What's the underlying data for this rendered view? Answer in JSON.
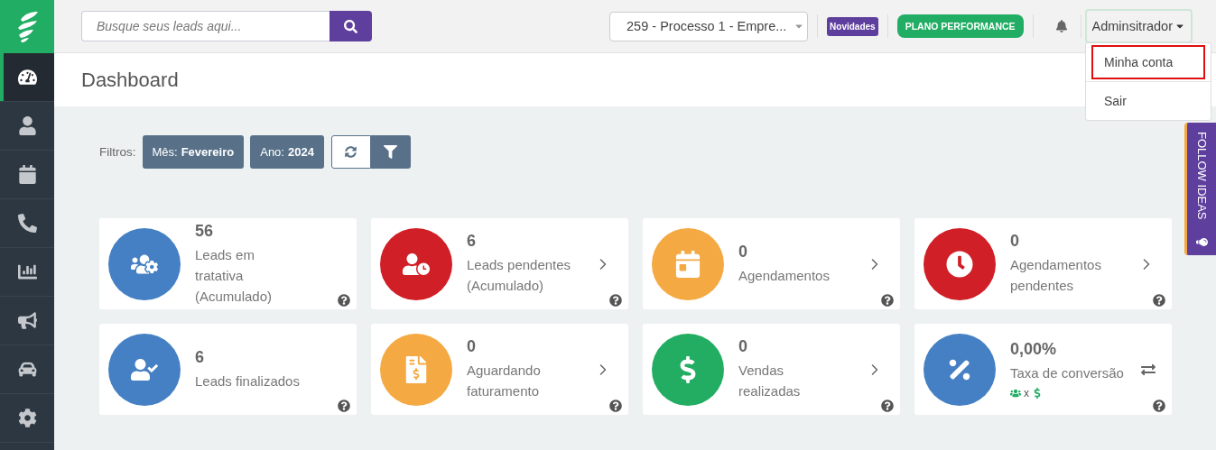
{
  "sidebar": {
    "items": [
      {
        "selected": true
      },
      {
        "selected": false
      },
      {
        "selected": false
      },
      {
        "selected": false
      },
      {
        "selected": false
      },
      {
        "selected": false
      },
      {
        "selected": false
      },
      {
        "selected": false
      }
    ]
  },
  "topbar": {
    "search": {
      "placeholder": "Busque seus leads aqui..."
    },
    "process_select": {
      "value": "259 - Processo 1 - Empre..."
    },
    "news_badge": "Novidades",
    "plan_badge": "PLANO PERFORMANCE",
    "user_menu": {
      "label": "Adminsitrador",
      "expanded": true,
      "items": [
        {
          "label": "Minha conta",
          "selected": true
        },
        {
          "label": "Sair",
          "selected": false
        }
      ]
    }
  },
  "page_title": "Dashboard",
  "filters": {
    "label": "Filtros:",
    "chips": [
      {
        "key": "Mês:",
        "value": "Fevereiro"
      },
      {
        "key": "Ano:",
        "value": "2024"
      }
    ]
  },
  "cards": [
    {
      "kind": "plain",
      "color": "#4580c4",
      "value": "56",
      "label": "Leads em tratativa (Acumulado)"
    },
    {
      "kind": "link",
      "color": "#d01f26",
      "value": "6",
      "label": "Leads pendentes (Acumulado)"
    },
    {
      "kind": "link",
      "color": "#f4a942",
      "value": "0",
      "label": "Agendamentos"
    },
    {
      "kind": "link",
      "color": "#d01f26",
      "value": "0",
      "label": "Agendamentos pendentes"
    },
    {
      "kind": "plain",
      "color": "#4580c4",
      "value": "6",
      "label": "Leads finalizados"
    },
    {
      "kind": "link",
      "color": "#f4a942",
      "value": "0",
      "label": "Aguardando faturamento"
    },
    {
      "kind": "link",
      "color": "#23ad63",
      "value": "0",
      "label": "Vendas realizadas"
    },
    {
      "kind": "toggle",
      "color": "#4580c4",
      "value": "0,00%",
      "label": "Taxa de conversão",
      "formula": "x"
    }
  ],
  "follow_tab": "FOLLOW IDEAS"
}
